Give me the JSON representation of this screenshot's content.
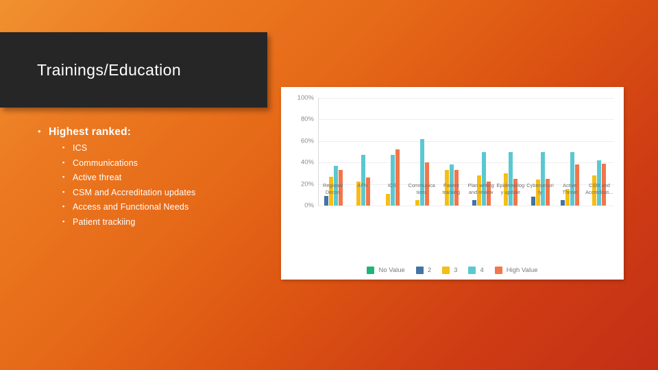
{
  "slide": {
    "title": "Trainings/Education"
  },
  "bullets": {
    "heading": "Highest ranked:",
    "marker_level1": "•",
    "marker_level2": "▪",
    "items": [
      "ICS",
      "Communications",
      "Active threat",
      "CSM and Accreditation updates",
      "Access and Functional Needs",
      "Patient trackiing"
    ]
  },
  "chart_data": {
    "type": "bar",
    "title": "",
    "xlabel": "",
    "ylabel": "",
    "ylim": [
      0,
      100
    ],
    "grid": true,
    "legend_position": "bottom",
    "ytick_labels": [
      "100%",
      "80%",
      "60%",
      "40%",
      "20%",
      "0%"
    ],
    "ytick_values": [
      100,
      80,
      60,
      40,
      20,
      0
    ],
    "categories": [
      "Regional Decon",
      "AFN",
      "ICS",
      "Communications",
      "Patient tracking",
      "Plan writing and review",
      "Epidemiology update",
      "Cybersecurity",
      "Active Threat",
      "CSM and Accreditati..."
    ],
    "series": [
      {
        "name": "No Value",
        "color": "#1fb57a",
        "values": [
          0,
          0,
          0,
          0,
          0,
          0,
          0,
          0,
          0,
          0
        ]
      },
      {
        "name": "2",
        "color": "#4374a3",
        "values": [
          9,
          0,
          0,
          0,
          0,
          5,
          0,
          8,
          5,
          0
        ]
      },
      {
        "name": "3",
        "color": "#f6bd16",
        "values": [
          27,
          22,
          11,
          5,
          33,
          28,
          30,
          24,
          15,
          28
        ]
      },
      {
        "name": "4",
        "color": "#5bc8d1",
        "values": [
          37,
          47,
          47,
          62,
          38,
          50,
          50,
          50,
          50,
          42
        ]
      },
      {
        "name": "High Value",
        "color": "#f2764a",
        "values": [
          33,
          26,
          52,
          40,
          33,
          22,
          25,
          25,
          38,
          39
        ]
      }
    ]
  },
  "colors": {
    "title_block": "#262626",
    "card": "#ffffff",
    "background_start": "#f0912f",
    "background_end": "#c22f16"
  }
}
